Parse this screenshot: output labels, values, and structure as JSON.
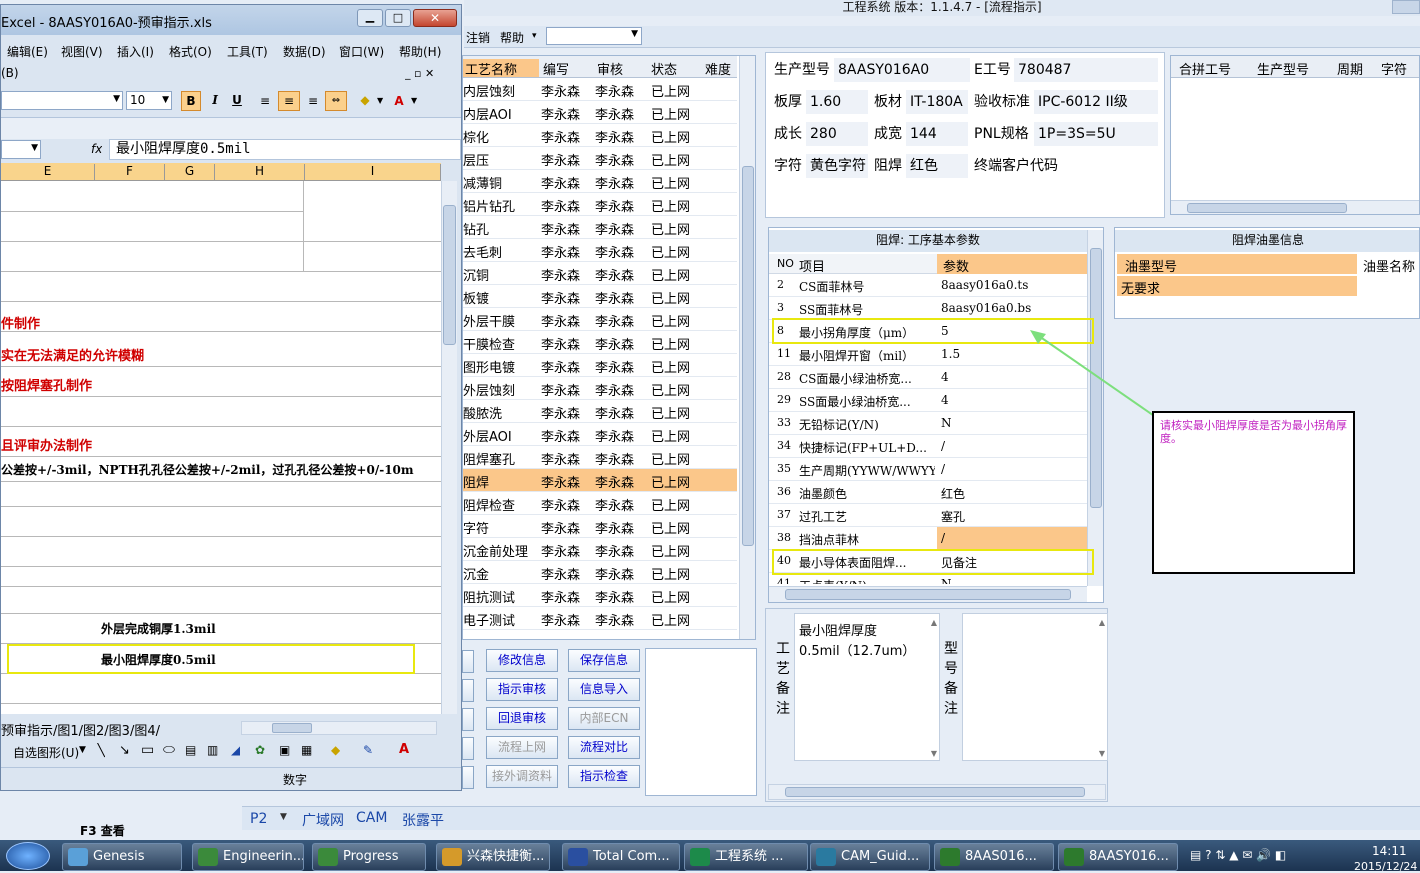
{
  "main": {
    "title": "工程系统  版本：1.1.4.7 - [流程指示]",
    "menu": [
      "注销",
      "帮助"
    ],
    "process_table": {
      "headers": [
        "工艺名称",
        "编写",
        "审核",
        "状态",
        "难度"
      ],
      "rows": [
        [
          "内层蚀刻",
          "李永森",
          "李永森",
          "已上网"
        ],
        [
          "内层AOI",
          "李永森",
          "李永森",
          "已上网"
        ],
        [
          "棕化",
          "李永森",
          "李永森",
          "已上网"
        ],
        [
          "层压",
          "李永森",
          "李永森",
          "已上网"
        ],
        [
          "减薄铜",
          "李永森",
          "李永森",
          "已上网"
        ],
        [
          "铝片钻孔",
          "李永森",
          "李永森",
          "已上网"
        ],
        [
          "钻孔",
          "李永森",
          "李永森",
          "已上网"
        ],
        [
          "去毛刺",
          "李永森",
          "李永森",
          "已上网"
        ],
        [
          "沉铜",
          "李永森",
          "李永森",
          "已上网"
        ],
        [
          "板镀",
          "李永森",
          "李永森",
          "已上网"
        ],
        [
          "外层干膜",
          "李永森",
          "李永森",
          "已上网"
        ],
        [
          "干膜检查",
          "李永森",
          "李永森",
          "已上网"
        ],
        [
          "图形电镀",
          "李永森",
          "李永森",
          "已上网"
        ],
        [
          "外层蚀刻",
          "李永森",
          "李永森",
          "已上网"
        ],
        [
          "酸脓洗",
          "李永森",
          "李永森",
          "已上网"
        ],
        [
          "外层AOI",
          "李永森",
          "李永森",
          "已上网"
        ],
        [
          "阻焊塞孔",
          "李永森",
          "李永森",
          "已上网"
        ],
        [
          "阻焊",
          "李永森",
          "李永森",
          "已上网"
        ],
        [
          "阻焊检查",
          "李永森",
          "李永森",
          "已上网"
        ],
        [
          "字符",
          "李永森",
          "李永森",
          "已上网"
        ],
        [
          "沉金前处理",
          "李永森",
          "李永森",
          "已上网"
        ],
        [
          "沉金",
          "李永森",
          "李永森",
          "已上网"
        ],
        [
          "阻抗测试",
          "李永森",
          "李永森",
          "已上网"
        ],
        [
          "电子测试",
          "李永森",
          "李永森",
          "已上网"
        ]
      ]
    },
    "buttons": {
      "modify": "修改信息",
      "save": "保存信息",
      "assign_review": "指示审核",
      "import": "信息导入",
      "return_review": "回退审核",
      "ecn": "内部ECN",
      "online": "流程上网",
      "compare": "流程对比",
      "external": "接外调资料",
      "check": "指示检查"
    },
    "info": {
      "model_label": "生产型号",
      "model": "8AASY016A0",
      "eno_label": "E工号",
      "eno": "780487",
      "thick_label": "板厚",
      "thick": "1.60",
      "material_label": "板材",
      "material": "IT-180A",
      "std_label": "验收标准",
      "std": "IPC-6012 II级",
      "len_label": "成长",
      "len": "280",
      "wid_label": "成宽",
      "wid": "144",
      "pnl_label": "PNL规格",
      "pnl": "1P=3S=5U",
      "char_label": "字符",
      "char": "黄色字符",
      "mask_label": "阻焊",
      "mask": "红色",
      "cust_label": "终端客户代码",
      "cust": ""
    },
    "merge_table": {
      "headers": [
        "合拼工号",
        "生产型号",
        "周期",
        "字符"
      ]
    },
    "params": {
      "title": "阻焊: 工序基本参数",
      "headers": [
        "NO",
        "项目",
        "参数"
      ],
      "rows": [
        [
          "2",
          "CS面菲林号",
          "8aasy016a0.ts"
        ],
        [
          "3",
          "SS面菲林号",
          "8aasy016a0.bs"
        ],
        [
          "8",
          "最小拐角厚度（μm）",
          "5"
        ],
        [
          "11",
          "最小阻焊开窗（mil）",
          "1.5"
        ],
        [
          "28",
          "CS面最小绿油桥宽...",
          "4"
        ],
        [
          "29",
          "SS面最小绿油桥宽...",
          "4"
        ],
        [
          "33",
          "无铅标记(Y/N)",
          "N"
        ],
        [
          "34",
          "快捷标记(FP+UL+D...",
          "/"
        ],
        [
          "35",
          "生产周期(YYWW/WWYY)",
          "/"
        ],
        [
          "36",
          "油墨颜色",
          "红色"
        ],
        [
          "37",
          "过孔工艺",
          "塞孔"
        ],
        [
          "38",
          "挡油点菲林",
          "/"
        ],
        [
          "40",
          "最小导体表面阻焊...",
          "见备注"
        ],
        [
          "41",
          "工点表(Y/N)",
          "N"
        ]
      ]
    },
    "ink": {
      "title": "阻焊油墨信息",
      "headers": [
        "油墨型号",
        "油墨名称"
      ],
      "row": [
        "无要求",
        ""
      ]
    },
    "annotation": "请核实最小阻焊厚度是否为最小拐角厚度。",
    "remark": {
      "label1": "工艺备注",
      "text1": "最小阻焊厚度",
      "text2": "0.5mil（12.7um）",
      "label2": "型号备注"
    },
    "status_tabs": [
      "P2",
      "广域网",
      "CAM",
      "张露平"
    ]
  },
  "excel": {
    "title": "Excel - 8AASY016A0-预审指示.xls",
    "menu": [
      "编辑(E)",
      "视图(V)",
      "插入(I)",
      "格式(O)",
      "工具(T)",
      "数据(D)",
      "窗口(W)",
      "帮助(H)"
    ],
    "menu2": "(B)",
    "font_size": "10",
    "formula": "最小阻焊厚度0.5mil",
    "fx": "fx",
    "columns": [
      "E",
      "F",
      "G",
      "H",
      "I"
    ],
    "lines": [
      "件制作",
      "实在无法满足的允许模糊",
      "按阻焊塞孔制作",
      "且评审办法制作",
      "公差按+/-3mil，NPTH孔孔径公差按+/-2mil，过孔孔径公差按+0/-10m",
      "外层完成铜厚1.3mil",
      "最小阻焊厚度0.5mil"
    ],
    "sheets": "预审指示/图1/图2/图3/图4/",
    "draw_label": "自选图形(U)",
    "status": "数字",
    "f3": "F3 查看"
  },
  "taskbar": {
    "items": [
      "Genesis",
      "Engineerin...",
      "Progress",
      "兴森快捷衡...",
      "Total Com...",
      "工程系统 ...",
      "CAM_Guid...",
      "8AAS016...",
      "8AASY016..."
    ],
    "time": "14:11",
    "date": "2015/12/24"
  }
}
